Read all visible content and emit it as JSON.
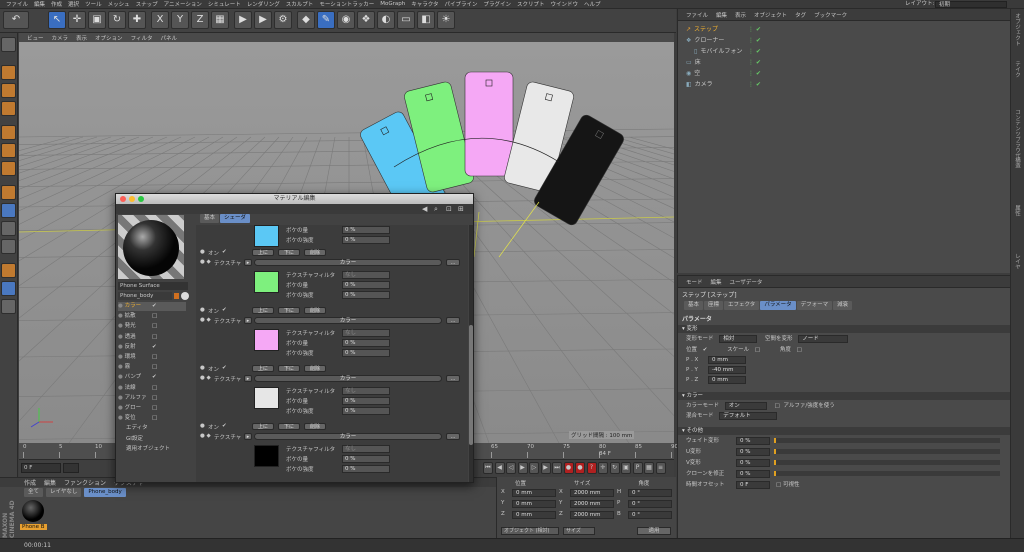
{
  "menubar": {
    "items": [
      "ファイル",
      "編集",
      "作成",
      "選択",
      "ツール",
      "メッシュ",
      "スナップ",
      "アニメーション",
      "シミュレート",
      "レンダリング",
      "スカルプト",
      "モーショントラッカー",
      "MoGraph",
      "キャラクタ",
      "パイプライン",
      "プラグイン",
      "スクリプト",
      "ウインドウ",
      "ヘルプ"
    ],
    "layout_label": "レイアウト:",
    "layout_value": "初期"
  },
  "viewport": {
    "menu": [
      "ビュー",
      "カメラ",
      "表示",
      "オプション",
      "フィルタ",
      "パネル"
    ],
    "label": "透視",
    "grid_label": "グリッド間隔 : 100 mm",
    "phone_colors": [
      "#5bc8f5",
      "#7ef07e",
      "#f5a8f5",
      "#e8e8e8",
      "#151515"
    ]
  },
  "object_manager": {
    "menu": [
      "ファイル",
      "編集",
      "表示",
      "オブジェクト",
      "タグ",
      "ブックマーク"
    ],
    "rows": [
      {
        "name": "ステップ",
        "indent": 0
      },
      {
        "name": "クローナー",
        "indent": 0
      },
      {
        "name": "モバイルフォン",
        "indent": 1
      },
      {
        "name": "床",
        "indent": 0
      },
      {
        "name": "空",
        "indent": 0
      },
      {
        "name": "カメラ",
        "indent": 0
      }
    ]
  },
  "attributes": {
    "menu": [
      "モード",
      "編集",
      "ユーザデータ"
    ],
    "title": "ステップ [ステップ]",
    "tabs": [
      "基本",
      "座標",
      "エフェクタ",
      "パラメータ",
      "デフォーマ",
      "減衰"
    ],
    "active_tab": "パラメータ",
    "section_title": "パラメータ",
    "deform_header": "▾ 変形",
    "deform_mode_label": "変形モード",
    "deform_mode_value": "相対",
    "deform_space_label": "空間を変形",
    "deform_space_value": "ノード",
    "position_label": "位置",
    "scale_label": "スケール",
    "angle_label": "角度",
    "px_label": "P . X",
    "px_value": "0 mm",
    "py_label": "P . Y",
    "py_value": "-40 mm",
    "pz_label": "P . Z",
    "pz_value": "0 mm",
    "color_header": "▾ カラー",
    "color_mode_label": "カラーモード",
    "color_mode_value": "オン",
    "alpha_label": "アルファ/強度を使う",
    "blend_label": "混合モード",
    "blend_value": "デフォルト",
    "other_header": "▾ その他",
    "weight_label": "ウェイト変形",
    "weight_value": "0 %",
    "u_label": "U変形",
    "u_value": "0 %",
    "v_label": "V変形",
    "v_value": "0 %",
    "clone_label": "クローンを修正",
    "clone_value": "0 %",
    "time_label": "時間オフセット",
    "time_value": "0 F",
    "visible_label": "可視性"
  },
  "material_dialog": {
    "title": "マテリアル編集",
    "material_name": "Phone Surface",
    "material_tag": "Phone_body",
    "channels": [
      "カラー",
      "拡散",
      "発光",
      "透過",
      "反射",
      "環境",
      "霧",
      "バンプ",
      "法線",
      "アルファ",
      "グロー",
      "変位",
      "エディタ",
      "GI設定",
      "適用オブジェクト"
    ],
    "channel_checked": [
      true,
      false,
      false,
      false,
      true,
      false,
      false,
      true,
      false,
      false,
      false,
      false
    ],
    "tabs": [
      "基本",
      "シェーダ"
    ],
    "bokeh_amount": "ボケの量",
    "bokeh_strength": "ボケの強度",
    "pct": "0 %",
    "on_label": "オン",
    "up_btn": "上に",
    "down_btn": "下に",
    "delete_btn": "削除",
    "texture_label": "テクスチャ",
    "color_label": "カラー",
    "filter_label": "テクスチャフィルタ",
    "filter_value": "なし",
    "layer_colors": [
      "#5bc8f5",
      "#7ef07e",
      "#f5a8f5",
      "#e6e6e6",
      "#000000"
    ]
  },
  "timeline": {
    "ticks": [
      "0",
      "5",
      "10",
      "15",
      "20",
      "25",
      "30",
      "35",
      "40",
      "45",
      "50",
      "55",
      "60",
      "65",
      "70",
      "75",
      "80",
      "85",
      "90"
    ],
    "current_frame": "0 F",
    "end_frame": "90 F",
    "current_right": "84 F"
  },
  "material_manager": {
    "menu": [
      "作成",
      "編集",
      "ファンクション",
      "テクスチャ"
    ],
    "tabs": [
      "全て",
      "レイヤなし",
      "Phone_body"
    ],
    "thumb_label": "Phone B"
  },
  "coordinates": {
    "headers": [
      "位置",
      "サイズ",
      "角度"
    ],
    "rows": [
      {
        "a": "X",
        "pos": "0 mm",
        "b": "X",
        "size": "2000 mm",
        "c": "H",
        "ang": "0 °"
      },
      {
        "a": "Y",
        "pos": "0 mm",
        "b": "Y",
        "size": "2000 mm",
        "c": "P",
        "ang": "0 °"
      },
      {
        "a": "Z",
        "pos": "0 mm",
        "b": "Z",
        "size": "2000 mm",
        "c": "B",
        "ang": "0 °"
      }
    ],
    "mode": "オブジェクト (相対)",
    "size_mode": "サイズ",
    "apply": "適用"
  },
  "status": {
    "time": "00:00:11",
    "brand": "MAXON CINEMA 4D"
  },
  "side_tabs": [
    "オブジェクト",
    "テイク",
    "コンテンツブラウザ",
    "構造",
    "属性",
    "レイヤ"
  ]
}
